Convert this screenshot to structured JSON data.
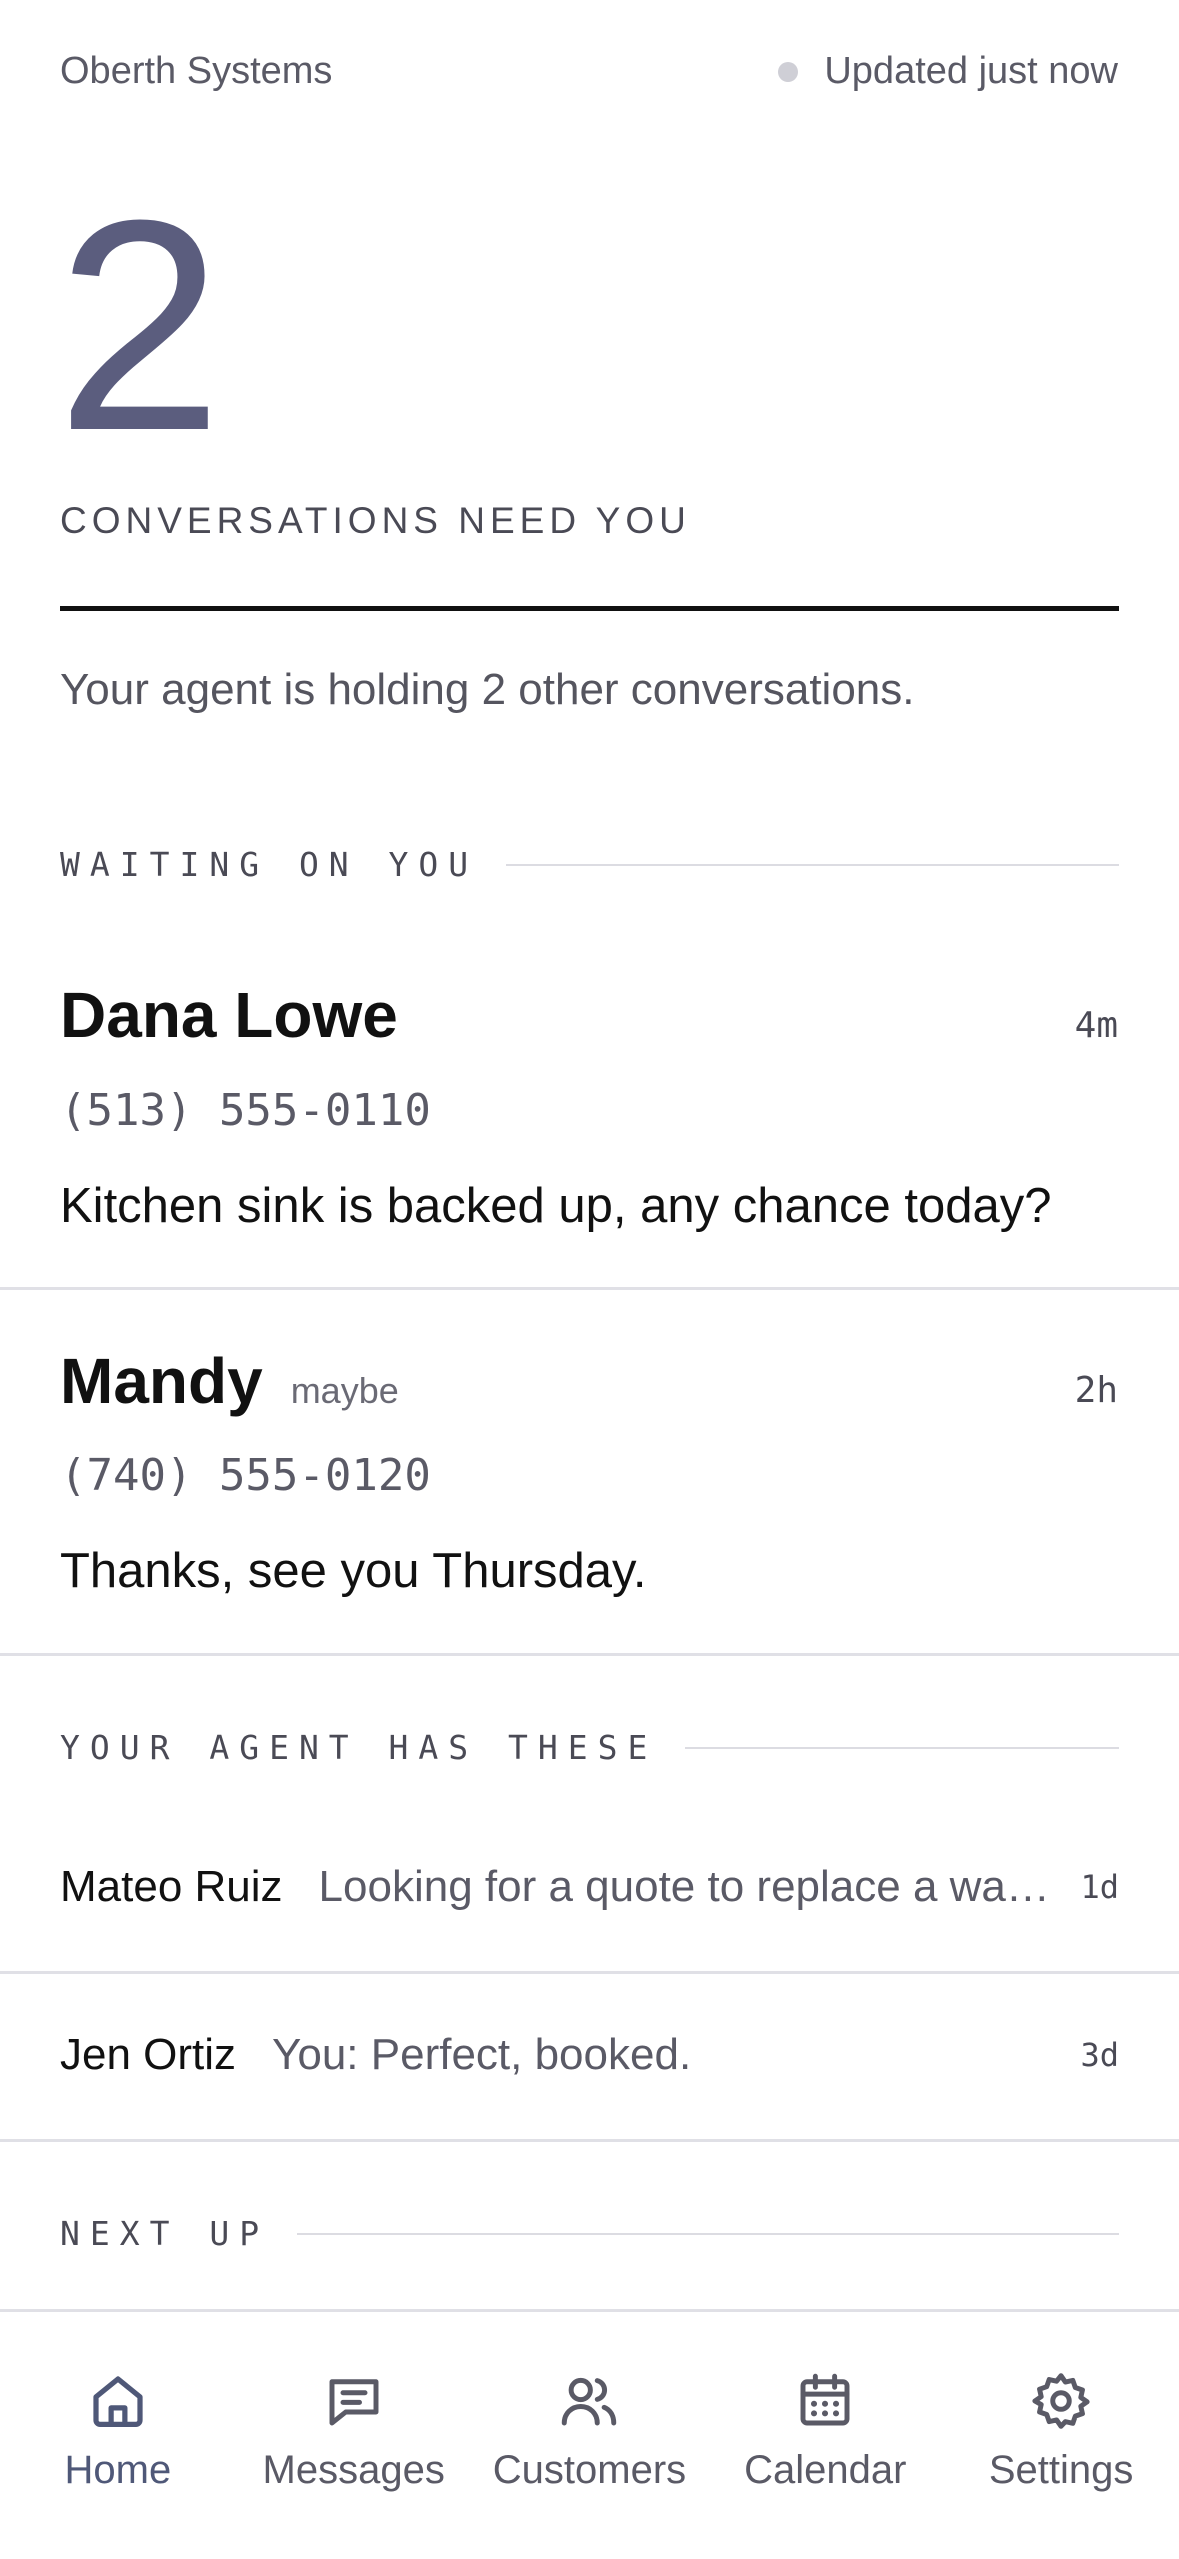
{
  "header": {
    "company": "Oberth Systems",
    "status": "Updated just now"
  },
  "summary": {
    "count": "2",
    "label": "CONVERSATIONS NEED YOU",
    "holding": "Your agent is holding 2 other conversations."
  },
  "waiting": {
    "title": "WAITING ON YOU",
    "items": [
      {
        "name": "Dana Lowe",
        "tag": "",
        "time": "4m",
        "phone": "(513) 555-0110",
        "message": "Kitchen sink is backed up, any chance today?"
      },
      {
        "name": "Mandy",
        "tag": "maybe",
        "time": "2h",
        "phone": "(740) 555-0120",
        "message": "Thanks, see you Thursday."
      }
    ]
  },
  "agent": {
    "title": "YOUR AGENT HAS THESE",
    "items": [
      {
        "name": "Mateo Ruiz",
        "preview": "Looking for a quote to replace a water heater",
        "time": "1d"
      },
      {
        "name": "Jen Ortiz",
        "preview": "You: Perfect, booked.",
        "time": "3d"
      }
    ]
  },
  "next_up": {
    "title": "NEXT UP"
  },
  "nav": {
    "items": [
      {
        "label": "Home",
        "icon": "home-icon",
        "active": true
      },
      {
        "label": "Messages",
        "icon": "messages-icon",
        "active": false
      },
      {
        "label": "Customers",
        "icon": "customers-icon",
        "active": false
      },
      {
        "label": "Calendar",
        "icon": "calendar-icon",
        "active": false
      },
      {
        "label": "Settings",
        "icon": "gear-icon",
        "active": false
      }
    ]
  },
  "colors": {
    "accent": "#5b5d7e",
    "text": "#111111",
    "muted": "#5a5a66",
    "divider": "#e0e0e6"
  }
}
